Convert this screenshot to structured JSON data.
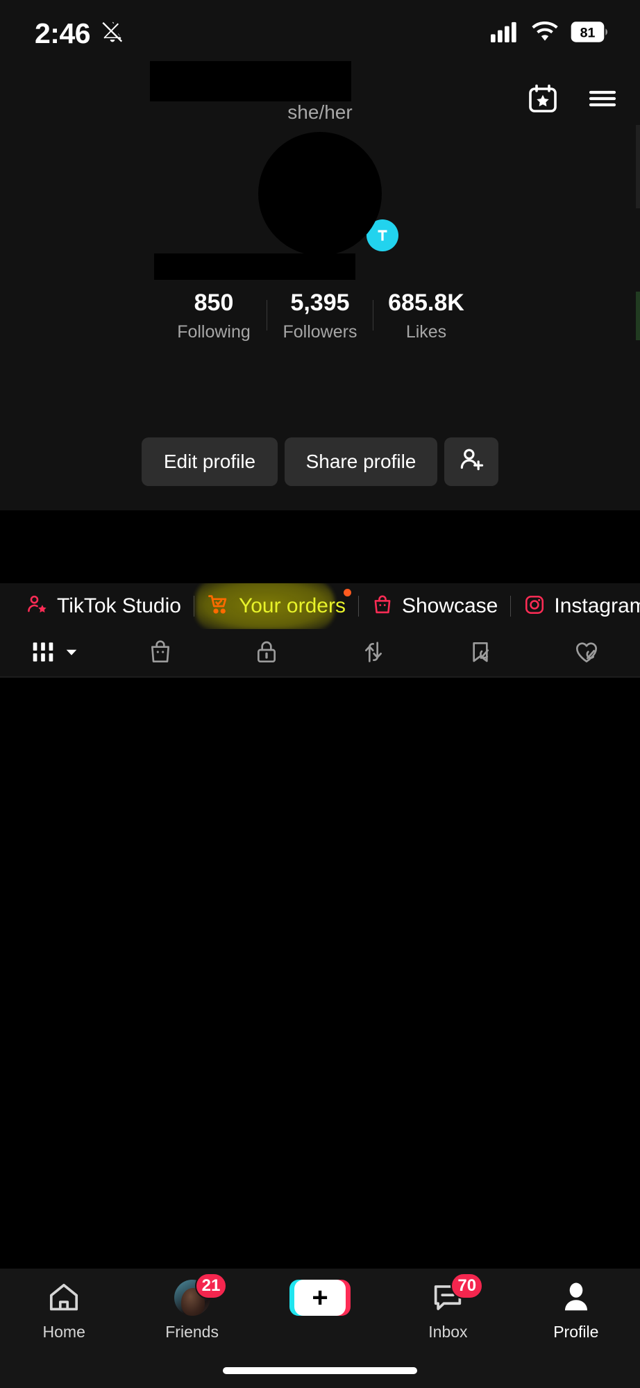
{
  "status_bar": {
    "time": "2:46",
    "silent_icon": "bell-slash-icon",
    "signal_icon": "cellular-signal-icon",
    "wifi_icon": "wifi-icon",
    "battery_level": "81"
  },
  "header": {
    "username_redacted": "",
    "pronouns": "she/her",
    "events_icon": "calendar-star-icon",
    "menu_icon": "hamburger-menu-icon"
  },
  "profile": {
    "avatar_redacted": "",
    "avatar_badge_color": "#22d3ee",
    "handle_redacted": "",
    "stats": [
      {
        "value": "850",
        "label": "Following"
      },
      {
        "value": "5,395",
        "label": "Followers"
      },
      {
        "value": "685.8K",
        "label": "Likes"
      }
    ],
    "actions": {
      "edit_label": "Edit profile",
      "share_label": "Share profile",
      "add_user_icon": "add-user-icon"
    },
    "bio_redacted": ""
  },
  "links": [
    {
      "label": "TikTok Studio",
      "icon": "person-star-icon",
      "color": "#fe2c55",
      "highlighted": false,
      "badge": false
    },
    {
      "label": "Your orders",
      "icon": "shopping-cart-check-icon",
      "color": "#ff6a00",
      "highlighted": true,
      "badge": true
    },
    {
      "label": "Showcase",
      "icon": "shopping-bag-icon",
      "color": "#fe2c55",
      "highlighted": false,
      "badge": false
    },
    {
      "label": "Instagram",
      "icon": "instagram-icon",
      "color": "#fe2c55",
      "highlighted": false,
      "badge": false
    }
  ],
  "tabs": [
    {
      "name": "videos-grid",
      "icon": "grid-bars-icon",
      "active": true,
      "has_chevron": true
    },
    {
      "name": "shop",
      "icon": "shopping-bag-icon",
      "active": false,
      "has_chevron": false
    },
    {
      "name": "private",
      "icon": "lock-icon",
      "active": false,
      "has_chevron": false
    },
    {
      "name": "reposts",
      "icon": "repost-arrows-icon",
      "active": false,
      "has_chevron": false
    },
    {
      "name": "favorites",
      "icon": "bookmark-slash-icon",
      "active": false,
      "has_chevron": false
    },
    {
      "name": "liked",
      "icon": "heart-slash-icon",
      "active": false,
      "has_chevron": false
    }
  ],
  "bottom_nav": [
    {
      "label": "Home",
      "icon": "home-icon",
      "badge": "",
      "active": false
    },
    {
      "label": "Friends",
      "icon": "friends-avatar-icon",
      "badge": "21",
      "active": false
    },
    {
      "label": "",
      "icon": "create-plus-icon",
      "badge": "",
      "active": false
    },
    {
      "label": "Inbox",
      "icon": "inbox-message-icon",
      "badge": "70",
      "active": false
    },
    {
      "label": "Profile",
      "icon": "person-filled-icon",
      "badge": "",
      "active": true
    }
  ],
  "colors": {
    "background": "#121212",
    "redaction": "#000000",
    "accent_pink": "#fe2c55",
    "accent_cyan": "#20e5ef",
    "badge_red": "#f4264e",
    "highlight_yellow": "#e8f32a",
    "button_bg": "#2e2e2e"
  }
}
